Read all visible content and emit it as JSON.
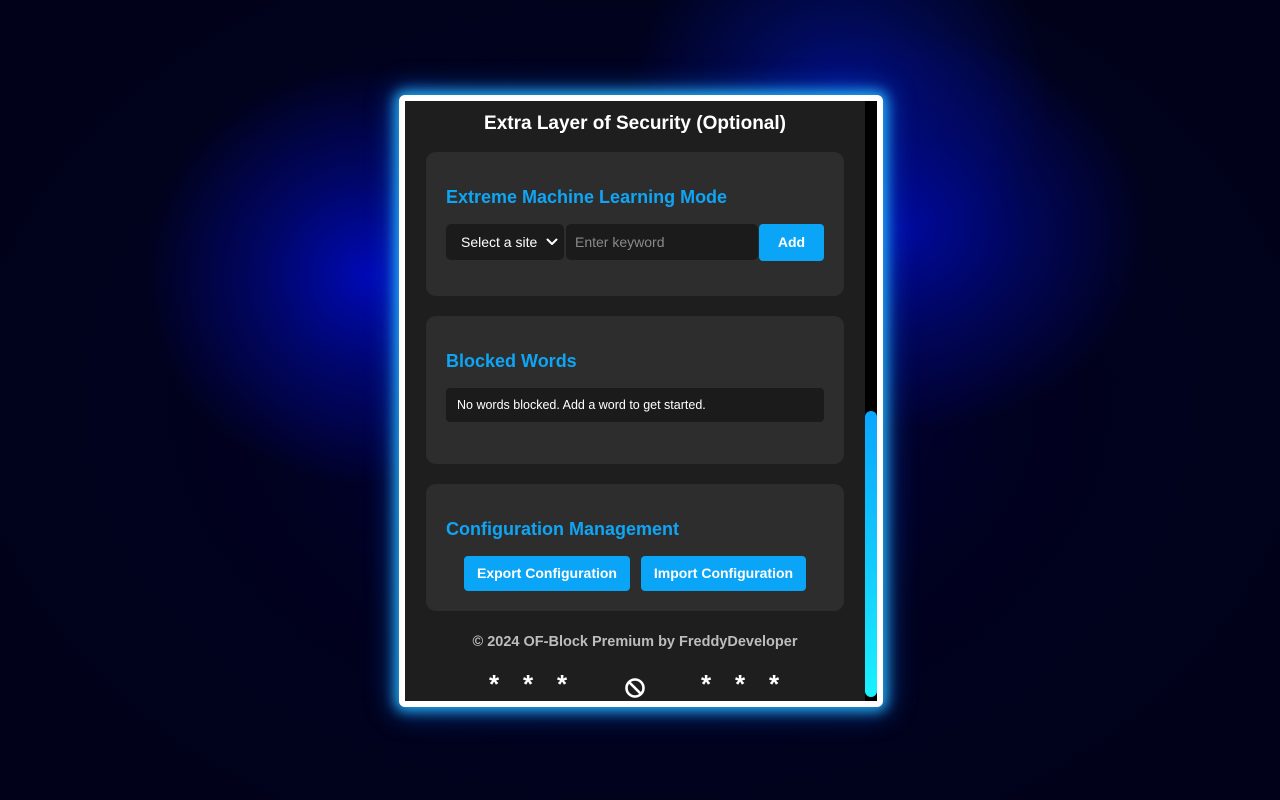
{
  "popup": {
    "title": "Extra Layer of Security (Optional)",
    "ml_section": {
      "title": "Extreme Machine Learning Mode",
      "site_select": {
        "selected": "Select a site",
        "icon": "chevron-down-icon"
      },
      "keyword_input": {
        "value": "",
        "placeholder": "Enter keyword"
      },
      "add_label": "Add"
    },
    "blocked_section": {
      "title": "Blocked Words",
      "empty_message": "No words blocked. Add a word to get started."
    },
    "config_section": {
      "title": "Configuration Management",
      "export_label": "Export Configuration",
      "import_label": "Import Configuration"
    },
    "footer": "© 2024 OF-Block Premium by FreddyDeveloper",
    "decoration": {
      "left_stars": [
        "*",
        "*",
        "*"
      ],
      "center_icon": "block-icon",
      "right_stars": [
        "*",
        "*",
        "*"
      ]
    }
  },
  "colors": {
    "accent": "#0aa5f7",
    "panel": "#1e1e1e",
    "card": "#2d2d2d",
    "input": "#1b1b1b",
    "glow": "#28beff"
  }
}
